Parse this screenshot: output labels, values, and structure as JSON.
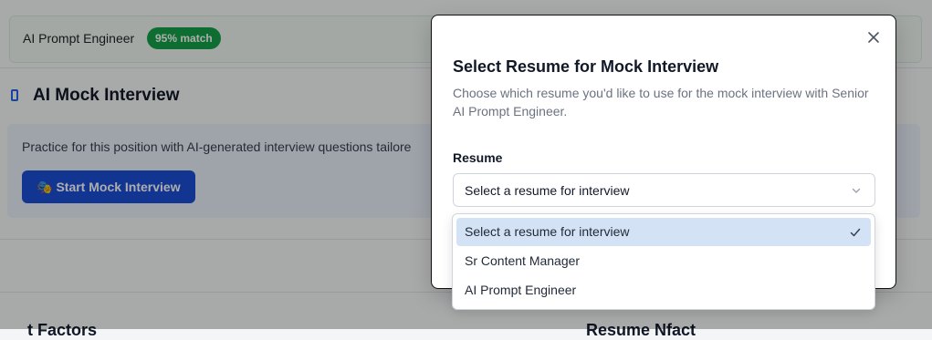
{
  "match": {
    "title": "AI Prompt Engineer",
    "badge": "95% match"
  },
  "section": {
    "title": "AI Mock Interview",
    "icon": "document-icon"
  },
  "practice": {
    "text": "Practice for this position with AI-generated interview questions tailore",
    "button_glyph": "🎭",
    "button_label": "Start Mock Interview"
  },
  "bottom": {
    "left_heading": "t Factors",
    "right_heading": "Resume Nfact"
  },
  "modal": {
    "title": "Select Resume for Mock Interview",
    "description": "Choose which resume you'd like to use for the mock interview with Senior AI Prompt Engineer.",
    "field_label": "Resume",
    "select_value": "Select a resume for interview",
    "options": [
      {
        "label": "Select a resume for interview",
        "selected": true
      },
      {
        "label": "Sr Content Manager",
        "selected": false
      },
      {
        "label": "AI Prompt Engineer",
        "selected": false
      }
    ]
  },
  "colors": {
    "accent": "#1d4ed8",
    "badge": "#16a34a",
    "selected_option": "#d4e2f5"
  }
}
